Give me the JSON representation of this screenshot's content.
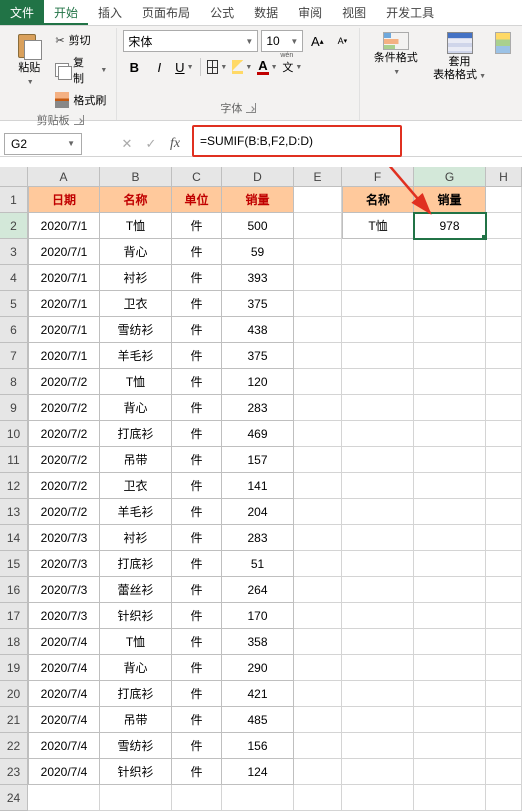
{
  "tabs": {
    "file": "文件",
    "home": "开始",
    "insert": "插入",
    "layout": "页面布局",
    "formula": "公式",
    "data": "数据",
    "review": "审阅",
    "view": "视图",
    "dev": "开发工具"
  },
  "clipboard": {
    "paste": "粘贴",
    "cut": "剪切",
    "copy": "复制",
    "painter": "格式刷",
    "group": "剪贴板"
  },
  "font": {
    "name": "宋体",
    "size": "10",
    "group": "字体"
  },
  "styles": {
    "condfmt": "条件格式",
    "tablefmt": "套用\n表格格式"
  },
  "namebox": "G2",
  "formula": "=SUMIF(B:B,F2,D:D)",
  "cols": [
    "A",
    "B",
    "C",
    "D",
    "E",
    "F",
    "G",
    "H"
  ],
  "header1": {
    "A": "日期",
    "B": "名称",
    "C": "单位",
    "D": "销量"
  },
  "header2": {
    "F": "名称",
    "G": "销量"
  },
  "result": {
    "F": "T恤",
    "G": "978"
  },
  "rows": [
    {
      "A": "2020/7/1",
      "B": "T恤",
      "C": "件",
      "D": "500"
    },
    {
      "A": "2020/7/1",
      "B": "背心",
      "C": "件",
      "D": "59"
    },
    {
      "A": "2020/7/1",
      "B": "衬衫",
      "C": "件",
      "D": "393"
    },
    {
      "A": "2020/7/1",
      "B": "卫衣",
      "C": "件",
      "D": "375"
    },
    {
      "A": "2020/7/1",
      "B": "雪纺衫",
      "C": "件",
      "D": "438"
    },
    {
      "A": "2020/7/1",
      "B": "羊毛衫",
      "C": "件",
      "D": "375"
    },
    {
      "A": "2020/7/2",
      "B": "T恤",
      "C": "件",
      "D": "120"
    },
    {
      "A": "2020/7/2",
      "B": "背心",
      "C": "件",
      "D": "283"
    },
    {
      "A": "2020/7/2",
      "B": "打底衫",
      "C": "件",
      "D": "469"
    },
    {
      "A": "2020/7/2",
      "B": "吊带",
      "C": "件",
      "D": "157"
    },
    {
      "A": "2020/7/2",
      "B": "卫衣",
      "C": "件",
      "D": "141"
    },
    {
      "A": "2020/7/2",
      "B": "羊毛衫",
      "C": "件",
      "D": "204"
    },
    {
      "A": "2020/7/3",
      "B": "衬衫",
      "C": "件",
      "D": "283"
    },
    {
      "A": "2020/7/3",
      "B": "打底衫",
      "C": "件",
      "D": "51"
    },
    {
      "A": "2020/7/3",
      "B": "蕾丝衫",
      "C": "件",
      "D": "264"
    },
    {
      "A": "2020/7/3",
      "B": "针织衫",
      "C": "件",
      "D": "170"
    },
    {
      "A": "2020/7/4",
      "B": "T恤",
      "C": "件",
      "D": "358"
    },
    {
      "A": "2020/7/4",
      "B": "背心",
      "C": "件",
      "D": "290"
    },
    {
      "A": "2020/7/4",
      "B": "打底衫",
      "C": "件",
      "D": "421"
    },
    {
      "A": "2020/7/4",
      "B": "吊带",
      "C": "件",
      "D": "485"
    },
    {
      "A": "2020/7/4",
      "B": "雪纺衫",
      "C": "件",
      "D": "156"
    },
    {
      "A": "2020/7/4",
      "B": "针织衫",
      "C": "件",
      "D": "124"
    }
  ]
}
